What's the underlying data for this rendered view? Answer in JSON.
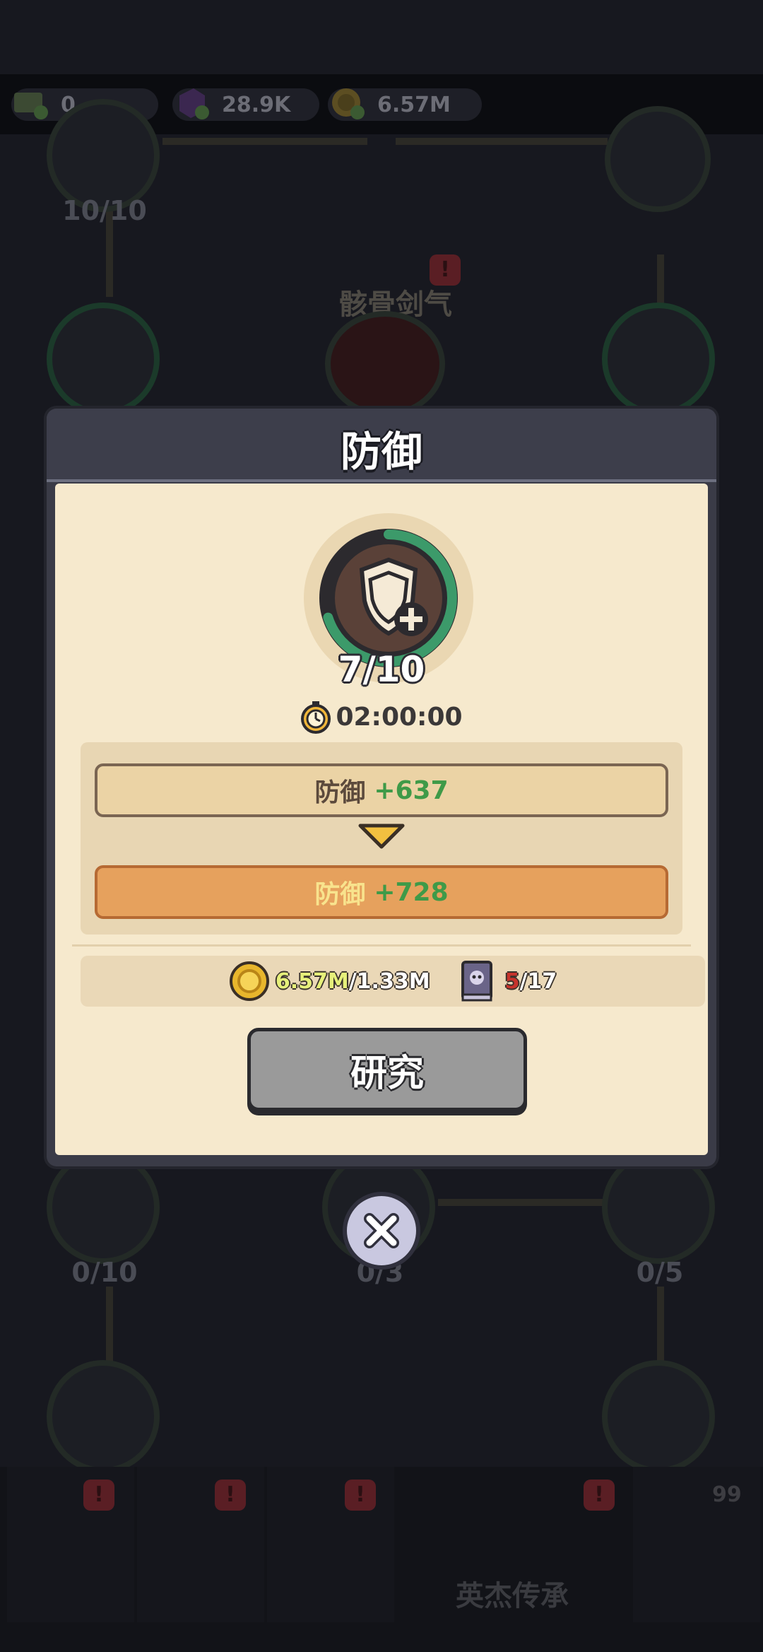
{
  "currency": [
    {
      "icon": "ticket-icon",
      "value": "0"
    },
    {
      "icon": "purple-gem-icon",
      "value": "28.9K"
    },
    {
      "icon": "gold-coin-icon",
      "value": "6.57M"
    }
  ],
  "background": {
    "node_counts": [
      "10/10",
      "0/10",
      "0/3",
      "0/5"
    ],
    "skill_name": "骸骨剑气",
    "nav": {
      "active_label": "英杰传承",
      "chest_badge": "99",
      "alert": "!"
    }
  },
  "modal": {
    "title": "防御",
    "level": "7/10",
    "level_progress": 0.7,
    "timer": "02:00:00",
    "current_stat": {
      "label": "防御",
      "value": "+637"
    },
    "next_stat": {
      "label": "防御",
      "value": "+728"
    },
    "cost": {
      "gold_have": "6.57M",
      "gold_need": "/1.33M",
      "book_have": "5",
      "book_need": "/17"
    },
    "research_label": "研究"
  },
  "colors": {
    "accent_green": "#3f9a48",
    "progress_green": "#3c9a6a",
    "shortfall_red": "#c7342c"
  }
}
